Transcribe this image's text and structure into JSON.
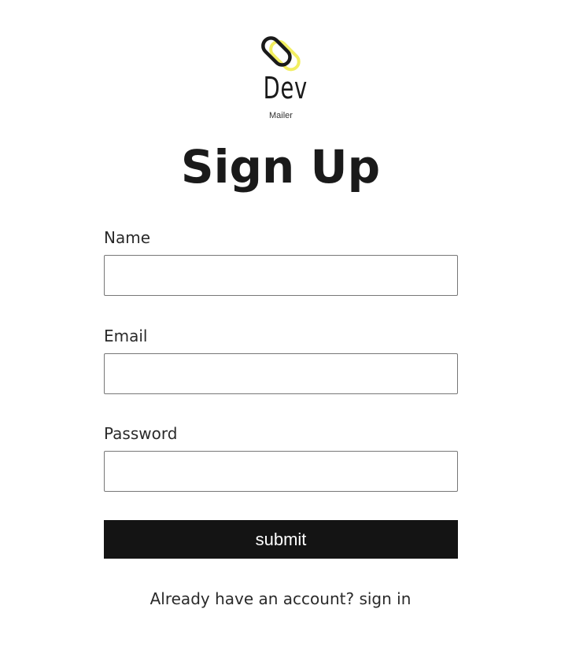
{
  "logo": {
    "icon": "paperclip-logo-icon",
    "word": "Dev",
    "sub": "Mailer",
    "accent_color": "#f2ee60"
  },
  "page_title": "Sign Up",
  "form": {
    "fields": [
      {
        "label": "Name",
        "value": "",
        "placeholder": ""
      },
      {
        "label": "Email",
        "value": "",
        "placeholder": ""
      },
      {
        "label": "Password",
        "value": "",
        "placeholder": ""
      }
    ],
    "submit_label": "submit"
  },
  "footer": {
    "prompt": "Already have an account?",
    "link": "sign in"
  },
  "colors": {
    "button_bg": "#141414",
    "button_text": "#ffffff",
    "text": "#1e1e1e"
  }
}
